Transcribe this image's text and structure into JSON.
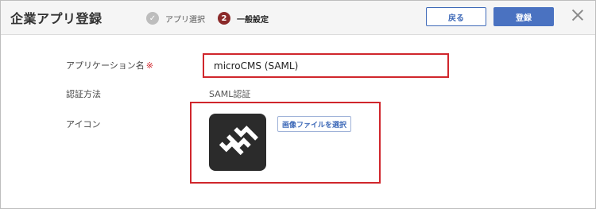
{
  "header": {
    "title": "企業アプリ登録",
    "steps": [
      {
        "label": "アプリ選択",
        "state": "done",
        "marker": "✓"
      },
      {
        "label": "一般設定",
        "state": "current",
        "marker": "2"
      }
    ],
    "back_label": "戻る",
    "register_label": "登録"
  },
  "form": {
    "app_name_label": "アプリケーション名",
    "required_mark": "※",
    "app_name_value": "microCMS (SAML)",
    "auth_method_label": "認証方法",
    "auth_method_value": "SAML認証",
    "icon_label": "アイコン",
    "select_image_label": "画像ファイルを選択"
  },
  "colors": {
    "accent": "#4a72c1",
    "highlight": "#d0262c",
    "current_step": "#8b2a2a"
  }
}
